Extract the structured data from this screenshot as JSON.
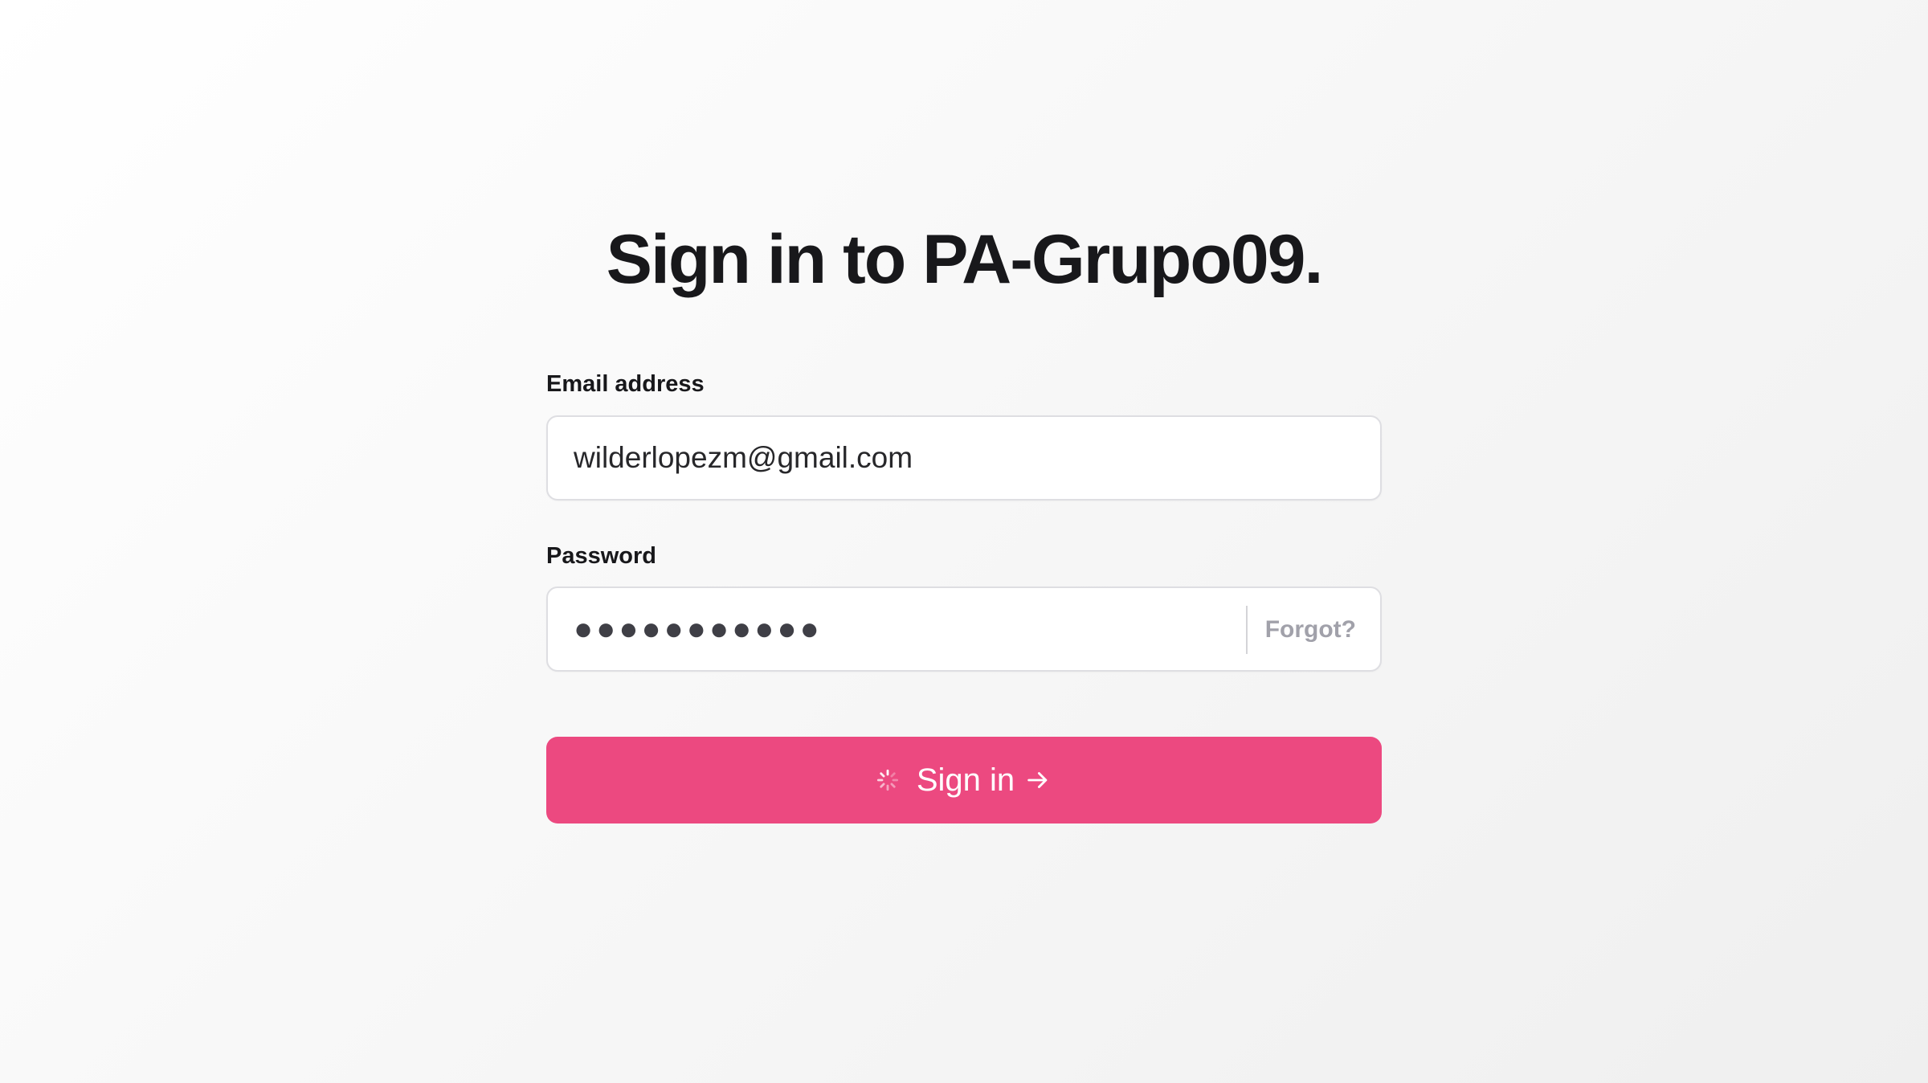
{
  "page": {
    "title": "Sign in to PA-Grupo09."
  },
  "form": {
    "email": {
      "label": "Email address",
      "value": "wilderlopezm@gmail.com"
    },
    "password": {
      "label": "Password",
      "value": "●●●●●●●●●●●",
      "forgot_label": "Forgot?"
    },
    "submit": {
      "label": "Sign in",
      "spinner_icon": "loading-spinner-icon",
      "arrow_icon": "arrow-right-icon"
    }
  },
  "colors": {
    "accent": "#ec4980",
    "text": "#18181b",
    "muted": "#a1a1aa",
    "border": "#dedee2"
  }
}
